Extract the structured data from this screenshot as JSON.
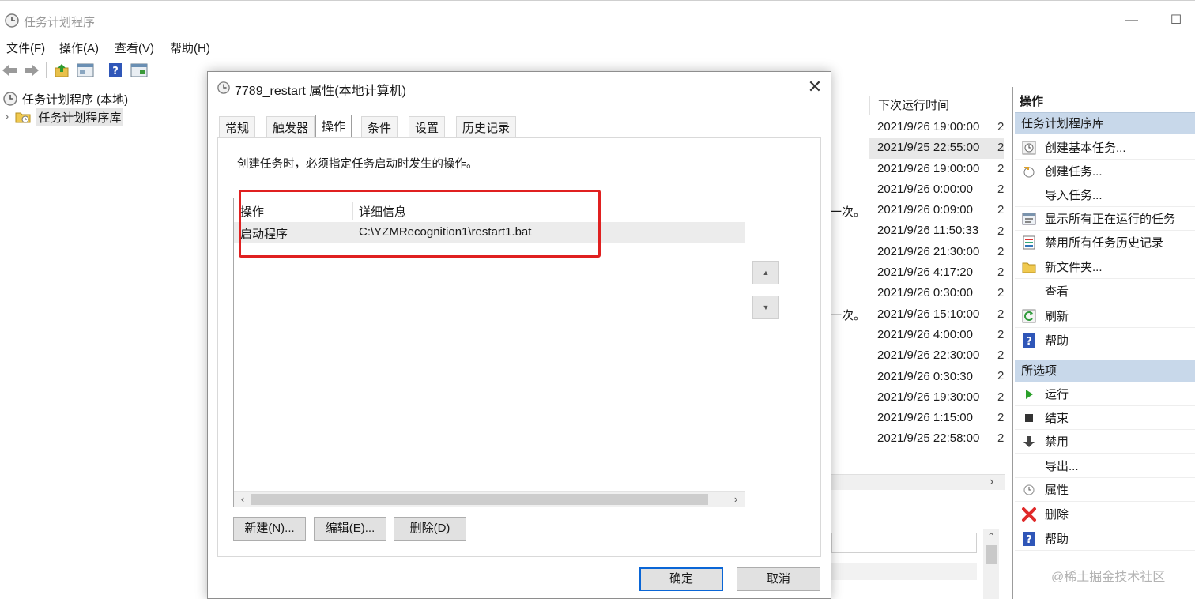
{
  "window": {
    "title": "任务计划程序",
    "minimize_glyph": "—",
    "maximize_glyph": "☐"
  },
  "menubar": [
    "文件(F)",
    "操作(A)",
    "查看(V)",
    "帮助(H)"
  ],
  "toolbar": {
    "icons": [
      "back-arrow-icon",
      "forward-arrow-icon",
      "up-folder-icon",
      "show-pane-icon",
      "help-icon",
      "properties-pane-icon"
    ]
  },
  "tree": {
    "root": "任务计划程序 (本地)",
    "child": "任务计划程序库",
    "expand_glyph": "›"
  },
  "tasklist": {
    "next_run_header": "下次运行时间",
    "next_run": [
      "2021/9/26 19:00:00",
      "2021/9/25 22:55:00",
      "2021/9/26 19:00:00",
      "2021/9/26 0:00:00",
      "2021/9/26 0:09:00",
      "2021/9/26 11:50:33",
      "2021/9/26 21:30:00",
      "2021/9/26 4:17:20",
      "2021/9/26 0:30:00",
      "2021/9/26 15:10:00",
      "2021/9/26 4:00:00",
      "2021/9/26 22:30:00",
      "2021/9/26 0:30:30",
      "2021/9/26 19:30:00",
      "2021/9/26 1:15:00",
      "2021/9/25 22:58:00"
    ],
    "clipped_char": "2",
    "once_text": "一次。",
    "scroll_right_glyph": "›",
    "scroll_up_glyph": "⌃"
  },
  "actions": {
    "title": "操作",
    "section1": "任务计划程序库",
    "section1_items": [
      {
        "label": "创建基本任务...",
        "icon": "create-basic-task-icon"
      },
      {
        "label": "创建任务...",
        "icon": "create-task-icon"
      },
      {
        "label": "导入任务...",
        "icon": ""
      },
      {
        "label": "显示所有正在运行的任务",
        "icon": "running-tasks-icon"
      },
      {
        "label": "禁用所有任务历史记录",
        "icon": "disable-history-icon"
      },
      {
        "label": "新文件夹...",
        "icon": "new-folder-icon"
      },
      {
        "label": "查看",
        "icon": ""
      },
      {
        "label": "刷新",
        "icon": "refresh-icon"
      },
      {
        "label": "帮助",
        "icon": "help-icon"
      }
    ],
    "section2": "所选项",
    "section2_items": [
      {
        "label": "运行",
        "icon": "run-icon"
      },
      {
        "label": "结束",
        "icon": "stop-icon"
      },
      {
        "label": "禁用",
        "icon": "disable-icon"
      },
      {
        "label": "导出...",
        "icon": ""
      },
      {
        "label": "属性",
        "icon": "properties-icon"
      },
      {
        "label": "删除",
        "icon": "delete-icon"
      },
      {
        "label": "帮助",
        "icon": "help-icon"
      }
    ]
  },
  "dialog": {
    "title": "7789_restart 属性(本地计算机)",
    "close_glyph": "✕",
    "tabs": [
      "常规",
      "触发器",
      "操作",
      "条件",
      "设置",
      "历史记录"
    ],
    "active_tab": "操作",
    "description": "创建任务时，必须指定任务启动时发生的操作。",
    "table": {
      "columns": [
        "操作",
        "详细信息"
      ],
      "rows": [
        {
          "action": "启动程序",
          "details": "C:\\YZMRecognition1\\restart1.bat"
        }
      ]
    },
    "scroll_left_glyph": "‹",
    "scroll_right_glyph": "›",
    "move_up_glyph": "▲",
    "move_down_glyph": "▼",
    "buttons": {
      "new": "新建(N)...",
      "edit": "编辑(E)...",
      "delete": "删除(D)",
      "ok": "确定",
      "cancel": "取消"
    }
  },
  "watermark": "@稀土掘金技术社区",
  "colors": {
    "highlight_box": "#e02020",
    "section_header": "#c8d8ea",
    "default_button_border": "#0a66d6"
  }
}
